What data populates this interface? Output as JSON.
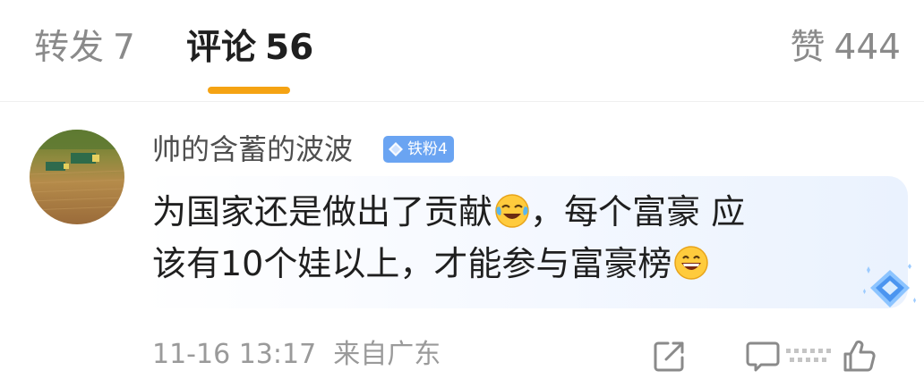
{
  "tabs": {
    "repost": {
      "label": "转发",
      "count": "7"
    },
    "comment": {
      "label": "评论",
      "count": "56"
    },
    "like": {
      "label": "赞",
      "count": "444"
    }
  },
  "comment": {
    "username": "帅的含蓄的波波",
    "badge": "铁粉4",
    "text_line1": "为国家还是做出了贡献",
    "text_line1b": "，每个富豪 应",
    "text_line2": "该有10个娃以上，才能参与富豪榜",
    "emoji1": "laughing-tears-emoji",
    "emoji2": "grinning-emoji",
    "timestamp": "11-16 13:17",
    "source": "来自广东"
  },
  "colors": {
    "accent": "#f5a313",
    "badge": "#6aa4f2",
    "muted": "#9a9a9a"
  }
}
